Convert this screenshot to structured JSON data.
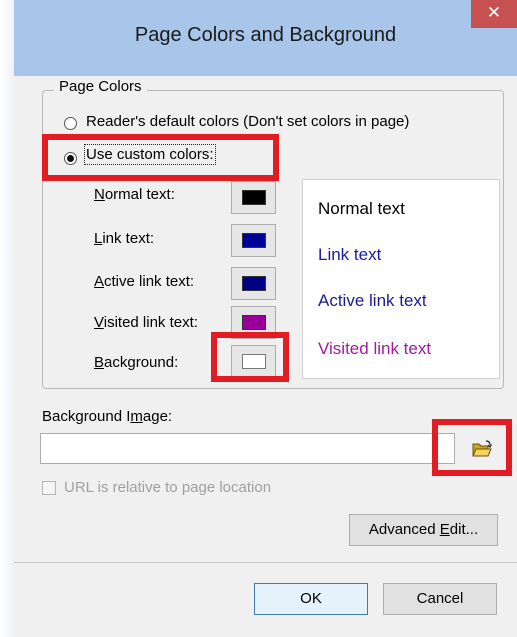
{
  "window": {
    "title": "Page Colors and Background",
    "close_label": "✕"
  },
  "page_colors": {
    "group_label": "Page Colors",
    "option_default": "Reader's default colors (Don't set colors in page)",
    "option_custom": "Use custom colors:",
    "selected": "custom",
    "rows": [
      {
        "pre": "",
        "acc": "N",
        "post": "ormal text:",
        "color": "#000000"
      },
      {
        "pre": "",
        "acc": "L",
        "post": "ink text:",
        "color": "#000099"
      },
      {
        "pre": "",
        "acc": "A",
        "post": "ctive link text:",
        "color": "#000088"
      },
      {
        "pre": "",
        "acc": "V",
        "post": "isited link text:",
        "color": "#990099"
      },
      {
        "pre": "",
        "acc": "B",
        "post": "ackground:",
        "color": "#ffffff"
      }
    ]
  },
  "preview": {
    "normal": "Normal text",
    "link": "Link text",
    "active": "Active link text",
    "visited": "Visited link text",
    "normal_color": "#000000",
    "link_color": "#1a1aa6",
    "active_color": "#1a1a99",
    "visited_color": "#a01ba0"
  },
  "background_image": {
    "label_pre": "Background I",
    "label_acc": "m",
    "label_post": "age:",
    "value": "",
    "browse_icon": "folder-open-icon",
    "relative_label": "URL is relative to page location",
    "relative_checked": false
  },
  "buttons": {
    "advanced_pre": "Advanced ",
    "advanced_acc": "E",
    "advanced_post": "dit...",
    "ok": "OK",
    "cancel": "Cancel"
  },
  "annotation_color": "#e31b23"
}
